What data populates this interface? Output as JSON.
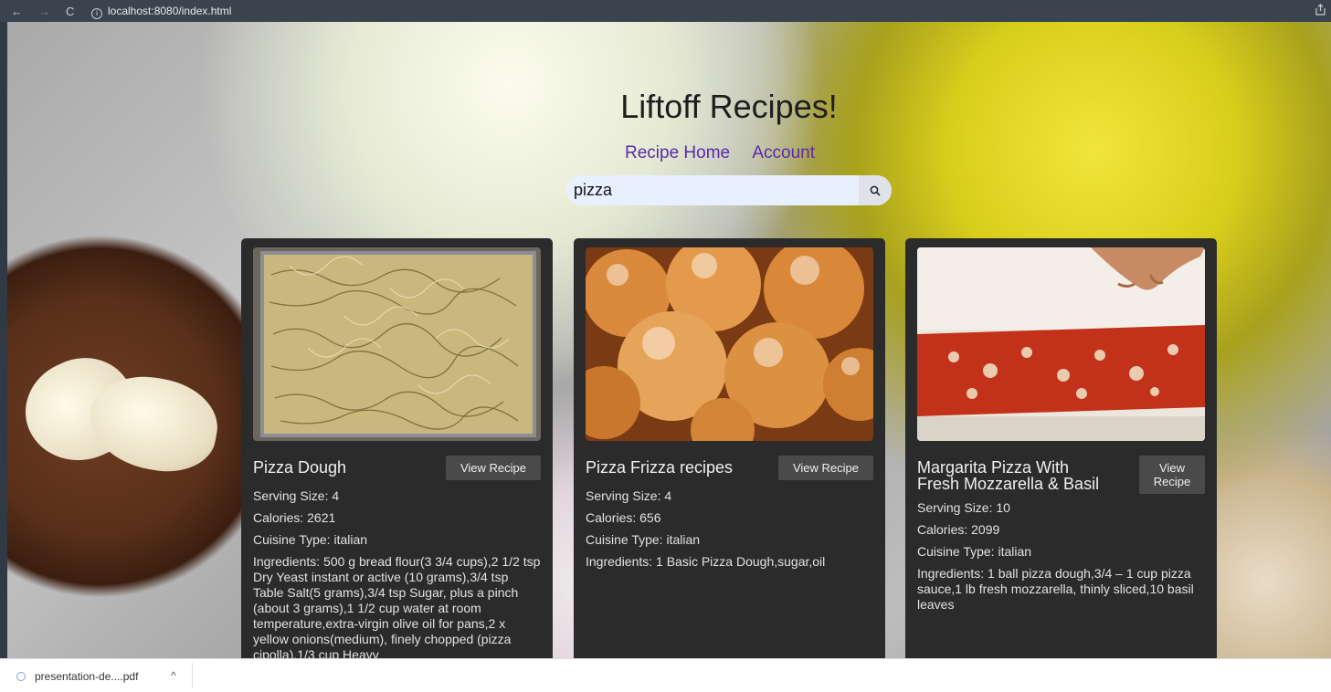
{
  "browser": {
    "back": "←",
    "forward": "→",
    "reload": "C",
    "url": "localhost:8080/index.html"
  },
  "page": {
    "title": "Liftoff Recipes!",
    "nav": [
      "Recipe Home",
      "Account"
    ],
    "search_value": "pizza"
  },
  "cards": [
    {
      "name": "Pizza Dough",
      "button": "View Recipe",
      "serving": "Serving Size: 4",
      "calories": "Calories: 2621",
      "cuisine": "Cuisine Type: italian",
      "ingredients": "Ingredients: 500 g bread flour(3 3/4 cups),2 1/2 tsp Dry Yeast instant or active (10 grams),3/4 tsp Table Salt(5 grams),3/4 tsp Sugar, plus a pinch (about 3 grams),1 1/2 cup water at room temperature,extra-virgin olive oil for pans,2 x yellow onions(medium), finely chopped (pizza cipolla),1/3 cup Heavy"
    },
    {
      "name": "Pizza Frizza recipes",
      "button": "View Recipe",
      "serving": "Serving Size: 4",
      "calories": "Calories: 656",
      "cuisine": "Cuisine Type: italian",
      "ingredients": "Ingredients: 1 Basic Pizza Dough,sugar,oil"
    },
    {
      "name": "Margarita Pizza With Fresh Mozzarella & Basil",
      "button": "View Recipe",
      "serving": "Serving Size: 10",
      "calories": "Calories: 2099",
      "cuisine": "Cuisine Type: italian",
      "ingredients": "Ingredients: 1 ball pizza dough,3/4 – 1 cup pizza sauce,1 lb fresh mozzarella, thinly sliced,10 basil leaves"
    }
  ],
  "downloads": {
    "file": "presentation-de....pdf",
    "chevron": "^"
  }
}
